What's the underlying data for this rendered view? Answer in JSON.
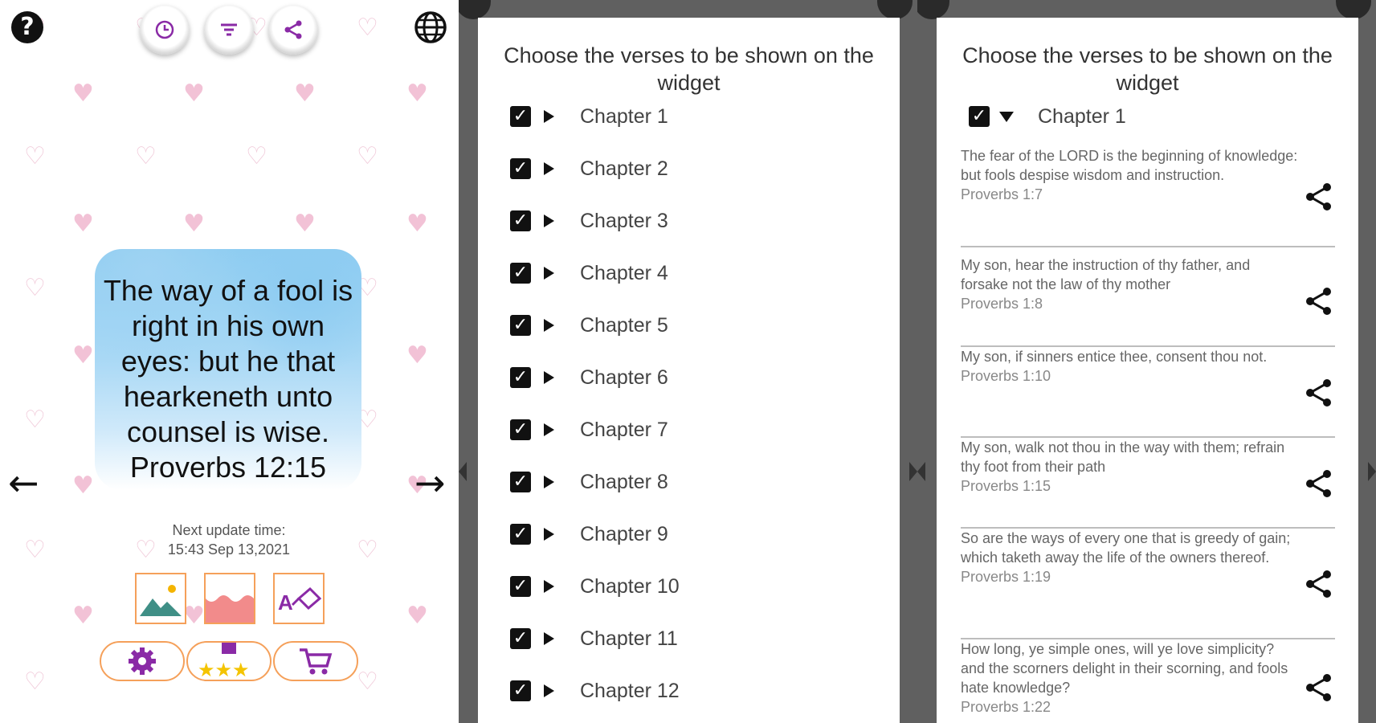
{
  "panel1": {
    "help_icon": "question-icon",
    "globe_icon": "globe-icon",
    "top_buttons": [
      {
        "name": "history-button",
        "icon": "clock-icon"
      },
      {
        "name": "filter-button",
        "icon": "filter-icon"
      },
      {
        "name": "share-button",
        "icon": "share-icon"
      }
    ],
    "verse_text": "The way of a fool is right in his own eyes: but he that hearkeneth unto counsel is wise.",
    "verse_ref": "Proverbs 12:15",
    "prev_arrow": "←",
    "next_arrow": "→",
    "update_label": "Next update time:",
    "update_time": "15:43 Sep 13,2021",
    "tiles": [
      {
        "name": "background-image-tile",
        "icon": "landscape-icon"
      },
      {
        "name": "wave-style-tile",
        "icon": "wave-icon"
      },
      {
        "name": "text-style-tile",
        "icon": "text-paint-icon"
      }
    ],
    "pill_buttons": [
      {
        "name": "settings-button",
        "icon": "gear-icon"
      },
      {
        "name": "rate-button",
        "icon": "stars-icon"
      },
      {
        "name": "shop-button",
        "icon": "cart-icon"
      }
    ],
    "colors": {
      "accent_purple": "#8a2aa6",
      "tile_border": "#f5a05a",
      "heart_pink": "#f2c2d6",
      "card_blue": "#8fcdf1"
    }
  },
  "panel2": {
    "title": "Choose the verses to be shown on the widget",
    "chapters": [
      "Chapter 1",
      "Chapter 2",
      "Chapter 3",
      "Chapter 4",
      "Chapter 5",
      "Chapter 6",
      "Chapter 7",
      "Chapter 8",
      "Chapter 9",
      "Chapter 10",
      "Chapter 11",
      "Chapter 12"
    ],
    "check_glyph": "✓"
  },
  "panel3": {
    "title": "Choose the verses to be shown on the widget",
    "chapter_label": "Chapter 1",
    "check_glyph": "✓",
    "verses": [
      {
        "text": "The fear of the LORD is the beginning of knowledge: but fools despise wisdom and instruction.",
        "ref": "Proverbs 1:7"
      },
      {
        "text": "My son, hear the instruction of thy father, and forsake not the law of thy mother",
        "ref": "Proverbs 1:8"
      },
      {
        "text": "My son, if sinners entice thee, consent thou not.",
        "ref": "Proverbs 1:10"
      },
      {
        "text": "My son, walk not thou in the way with them; refrain thy foot from their path",
        "ref": "Proverbs 1:15"
      },
      {
        "text": "So are the ways of every one that is greedy of gain; which taketh away the life of the owners thereof.",
        "ref": "Proverbs 1:19"
      },
      {
        "text": "How long, ye simple ones, will ye love simplicity? and the scorners delight in their scorning, and fools hate knowledge?",
        "ref": "Proverbs 1:22"
      }
    ]
  }
}
